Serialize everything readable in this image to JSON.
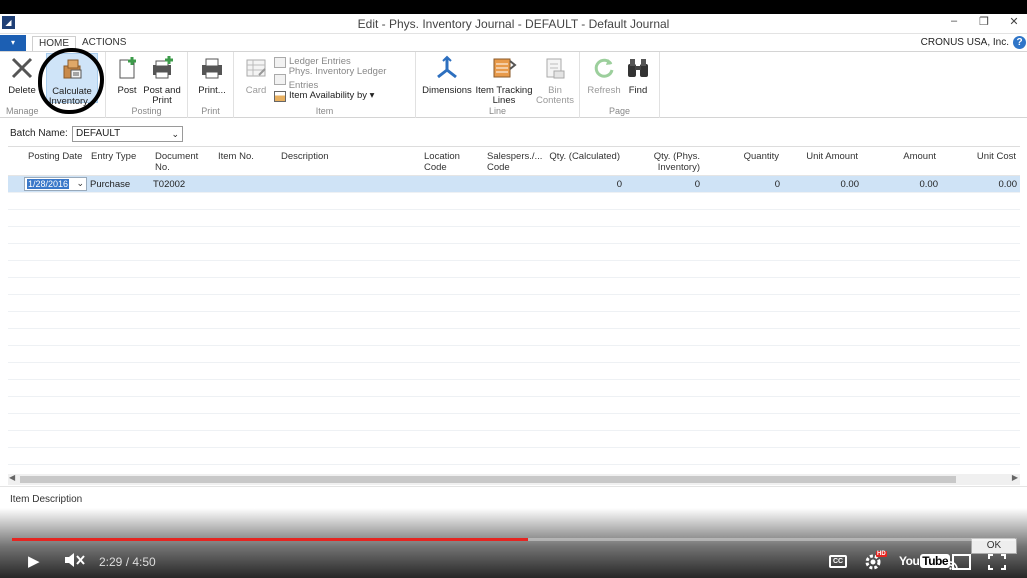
{
  "window": {
    "title": "Edit - Phys. Inventory Journal - DEFAULT - Default Journal",
    "minimize": "–",
    "restore": "❐",
    "close": "✕"
  },
  "tabs": {
    "menu_arrow": "▾",
    "home": "HOME",
    "actions": "ACTIONS",
    "company": "CRONUS USA, Inc.",
    "help": "?"
  },
  "ribbon": {
    "manage": {
      "label": "Manage",
      "delete": "Delete",
      "calculate_inventory": "Calculate Inventory..."
    },
    "posting": {
      "label": "Posting",
      "post": "Post",
      "post_and_print": "Post and Print"
    },
    "print": {
      "label": "Print",
      "print": "Print..."
    },
    "item": {
      "label": "Item",
      "card": "Card",
      "ledger_entries": "Ledger Entries",
      "phys_inventory_ledger_entries": "Phys. Inventory Ledger Entries",
      "item_availability_by": "Item Availability by ▾"
    },
    "line": {
      "label": "Line",
      "dimensions": "Dimensions",
      "item_tracking_lines": "Item Tracking Lines",
      "bin_contents": "Bin Contents"
    },
    "page": {
      "label": "Page",
      "refresh": "Refresh",
      "find": "Find"
    }
  },
  "batch": {
    "label": "Batch Name:",
    "value": "DEFAULT",
    "chevron": "⌄"
  },
  "grid": {
    "columns": [
      "Posting Date",
      "Entry Type",
      "Document No.",
      "Item No.",
      "Description",
      "Location Code",
      "Salespers./... Code",
      "Qty. (Calculated)",
      "Qty. (Phys. Inventory)",
      "Quantity",
      "Unit Amount",
      "Amount",
      "Unit Cost"
    ],
    "rows": [
      {
        "posting_date": "1/28/2016",
        "entry_type": "Purchase",
        "document_no": "T02002",
        "item_no": "",
        "description": "",
        "location_code": "",
        "salesperson_code": "",
        "qty_calculated": "0",
        "qty_phys_inventory": "0",
        "quantity": "0",
        "unit_amount": "0.00",
        "amount": "0.00",
        "unit_cost": "0.00"
      }
    ],
    "date_chevron": "⌄",
    "scroll_left": "◀",
    "scroll_right": "▶"
  },
  "factbox": {
    "label": "Item Description"
  },
  "dialog": {
    "ok": "OK"
  },
  "player": {
    "time": "2:29 / 4:50",
    "progress": 0.514,
    "play": "▶",
    "mute": "✕",
    "cc": "CC",
    "hd": "HD",
    "youtube_a": "You",
    "youtube_b": "Tube"
  }
}
